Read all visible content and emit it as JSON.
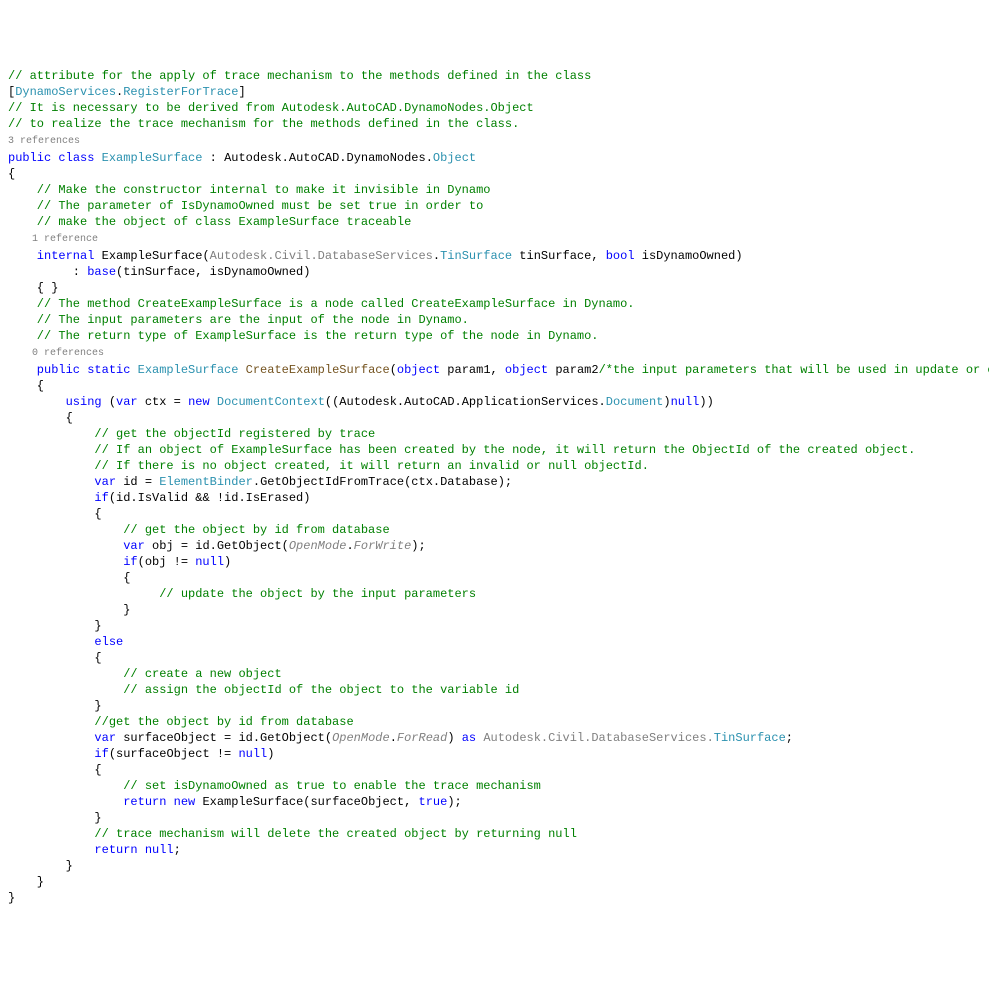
{
  "lines": {
    "l1": "// attribute for the apply of trace mechanism to the methods defined in the class",
    "l2a": "[",
    "l2b": "DynamoServices",
    "l2c": ".",
    "l2d": "RegisterForTrace",
    "l2e": "]",
    "l3": "// It is necessary to be derived from Autodesk.AutoCAD.DynamoNodes.Object",
    "l4": "// to realize the trace mechanism for the methods defined in the class.",
    "l5": "3 references",
    "l6a": "public",
    "l6b": " class ",
    "l6c": "ExampleSurface",
    "l6d": " : Autodesk.AutoCAD.DynamoNodes.",
    "l6e": "Object",
    "l7": "{",
    "l8": "    // Make the constructor internal to make it invisible in Dynamo",
    "l9": "    // The parameter of IsDynamoOwned must be set true in order to",
    "l10": "    // make the object of class ExampleSurface traceable",
    "l11": "    1 reference",
    "l12a": "    internal",
    "l12b": " ExampleSurface(",
    "l12c": "Autodesk.Civil.DatabaseServices",
    "l12d": ".",
    "l12e": "TinSurface",
    "l12f": " tinSurface, ",
    "l12g": "bool",
    "l12h": " isDynamoOwned)",
    "l13a": "         : ",
    "l13b": "base",
    "l13c": "(tinSurface, isDynamoOwned)",
    "l14": "    { }",
    "l15": "",
    "l16": "    // The method CreateExampleSurface is a node called CreateExampleSurface in Dynamo.",
    "l17": "    // The input parameters are the input of the node in Dynamo.",
    "l18": "    // The return type of ExampleSurface is the return type of the node in Dynamo.",
    "l19": "    0 references",
    "l20a": "    public",
    "l20b": " static ",
    "l20c": "ExampleSurface",
    "l20d": " ",
    "l20e": "CreateExampleSurface",
    "l20f": "(",
    "l20g": "object",
    "l20h": " param1, ",
    "l20i": "object",
    "l20j": " param2",
    "l20k": "/*the input parameters that will be used in update or creation*/",
    "l20l": ")",
    "l21": "    {",
    "l22": "",
    "l23": "",
    "l24a": "        using",
    "l24b": " (",
    "l24c": "var",
    "l24d": " ctx = ",
    "l24e": "new",
    "l24f1": " ",
    "l24f": "DocumentContext",
    "l24g": "((Autodesk.AutoCAD.ApplicationServices.",
    "l24h": "Document",
    "l24i": ")",
    "l24j": "null",
    "l24k": "))",
    "l25": "        {",
    "l26": "            // get the objectId registered by trace",
    "l27": "            // If an object of ExampleSurface has been created by the node, it will return the ObjectId of the created object.",
    "l28": "            // If there is no object created, it will return an invalid or null objectId.",
    "l29a": "            var",
    "l29b": " id = ",
    "l29c": "ElementBinder",
    "l29d": ".GetObjectIdFromTrace(ctx.Database);",
    "l30a": "            if",
    "l30b": "(id.IsValid && !id.IsErased)",
    "l31": "            {",
    "l32": "                // get the object by id from database",
    "l33a": "                var",
    "l33b": " obj = id.GetObject(",
    "l33c": "OpenMode",
    "l33d": ".",
    "l33e": "ForWrite",
    "l33f": ");",
    "l34a": "                if",
    "l34b": "(obj != ",
    "l34c": "null",
    "l34d": ")",
    "l35": "                {",
    "l36": "                     // update the object by the input parameters",
    "l37": "                }",
    "l38": "            }",
    "l39a": "            else",
    "l40": "            {",
    "l41": "                // create a new object",
    "l42": "                // assign the objectId of the object to the variable id",
    "l43": "            }",
    "l44": "",
    "l45": "            //get the object by id from database",
    "l46a": "            var",
    "l46b": " surfaceObject = id.GetObject(",
    "l46c": "OpenMode",
    "l46d": ".",
    "l46e": "ForRead",
    "l46f": ") ",
    "l46g": "as",
    "l46h": " Autodesk.Civil.DatabaseServices.",
    "l46i": "TinSurface",
    "l46j": ";",
    "l47a": "            if",
    "l47b": "(surfaceObject != ",
    "l47c": "null",
    "l47d": ")",
    "l48": "            {",
    "l49": "                // set isDynamoOwned as true to enable the trace mechanism",
    "l50a": "                return",
    "l50b": " new",
    "l50c": " ExampleSurface(surfaceObject, ",
    "l50d": "true",
    "l50e": ");",
    "l51": "            }",
    "l52": "            // trace mechanism will delete the created object by returning null",
    "l53a": "            return",
    "l53b": " null",
    "l53c": ";",
    "l54": "        }",
    "l55": "",
    "l56": "",
    "l57": "    }",
    "l58": "}"
  }
}
